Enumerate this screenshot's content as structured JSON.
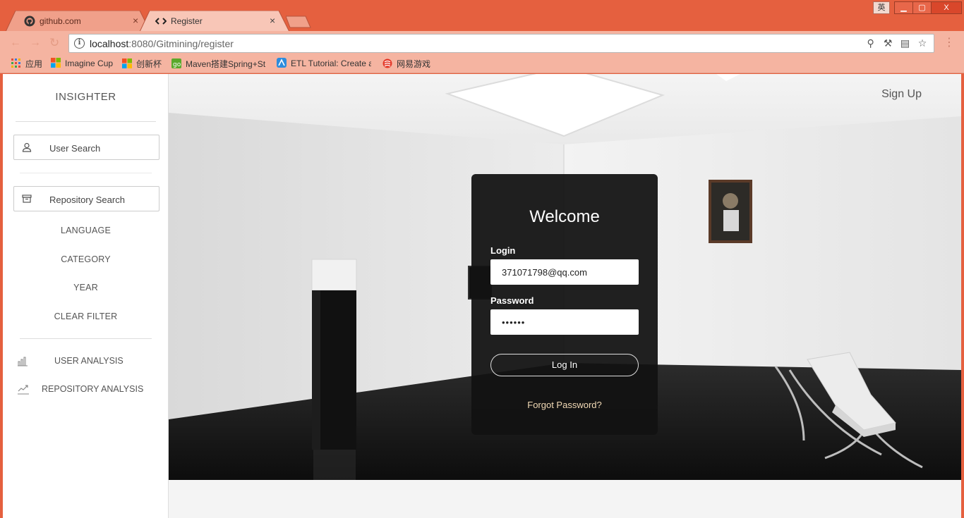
{
  "browser": {
    "tabs": [
      {
        "title": "github.com",
        "favicon": "github-icon",
        "active": false,
        "close": "×"
      },
      {
        "title": "Register",
        "favicon": "code-icon",
        "active": true,
        "close": "×"
      }
    ],
    "window_controls": {
      "ime": "英",
      "minimize": "▁",
      "maximize": "▢",
      "close": "X"
    },
    "address": {
      "host": "localhost",
      "path": ":8080/Gitmining/register"
    },
    "bookmarks": [
      {
        "label": "应用",
        "icon": "apps-grid-icon"
      },
      {
        "label": "Imagine Cup",
        "icon": "microsoft-logo-icon"
      },
      {
        "label": "创新杯",
        "icon": "microsoft-logo-icon"
      },
      {
        "label": "Maven搭建Spring+St",
        "icon": "bookmark-green-icon"
      },
      {
        "label": "ETL Tutorial: Create a",
        "icon": "bookmark-blue-icon"
      },
      {
        "label": "网易游戏",
        "icon": "netease-icon"
      }
    ],
    "colors": {
      "frame": "#e5603f",
      "toolbar": "#f5b4a1"
    }
  },
  "sidebar": {
    "brand": "INSIGHTER",
    "user_search": "User Search",
    "repository_search": "Repository Search",
    "filters": [
      "LANGUAGE",
      "CATEGORY",
      "YEAR",
      "CLEAR FILTER"
    ],
    "user_analysis": "USER ANALYSIS",
    "repository_analysis": "REPOSITORY ANALYSIS"
  },
  "header": {
    "signup": "Sign Up"
  },
  "login": {
    "title": "Welcome",
    "login_label": "Login",
    "login_value": "371071798@qq.com",
    "password_label": "Password",
    "password_value": "••••••",
    "button": "Log In",
    "forgot": "Forgot Password?"
  }
}
